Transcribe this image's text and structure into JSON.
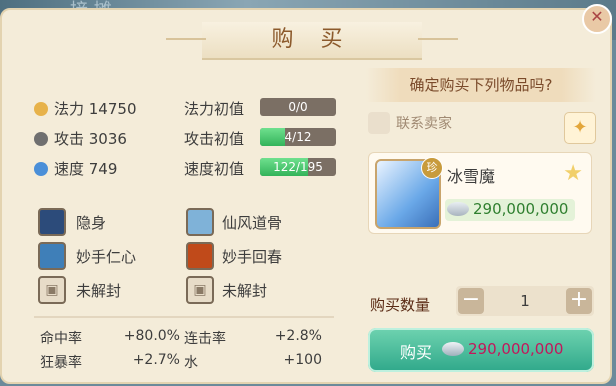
{
  "background_text": "接 摊",
  "title": "购 买",
  "stats": [
    {
      "label": "法力 14750",
      "icon": "mana-icon",
      "init_label": "法力初值",
      "bar": "0/0",
      "fill": 0
    },
    {
      "label": "攻击 3036",
      "icon": "attack-icon",
      "init_label": "攻击初值",
      "bar": "4/12",
      "fill": 0.33
    },
    {
      "label": "速度 749",
      "icon": "speed-icon",
      "init_label": "速度初值",
      "bar": "122/195",
      "fill": 0.63
    }
  ],
  "skills": [
    "隐身",
    "仙风道骨",
    "妙手仁心",
    "妙手回春",
    "未解封",
    "未解封"
  ],
  "attributes": [
    {
      "name": "命中率",
      "value": "+80.0%"
    },
    {
      "name": "连击率",
      "value": "+2.8%"
    },
    {
      "name": "狂暴率",
      "value": "+2.7%"
    },
    {
      "name": "水",
      "value": "+100"
    }
  ],
  "confirm_text": "确定购买下列物品吗?",
  "seller_label": "联系卖家",
  "item": {
    "badge": "珍",
    "name": "冰雪魔",
    "price": "290,000,000"
  },
  "quantity": {
    "label": "购买数量",
    "value": "1",
    "minus": "−",
    "plus": "+"
  },
  "buy": {
    "label": "购买",
    "price": "290,000,000"
  },
  "colors": {
    "accent": "#2fa88a",
    "price_red": "#c2185b",
    "bar_fill": "#33b35a"
  }
}
